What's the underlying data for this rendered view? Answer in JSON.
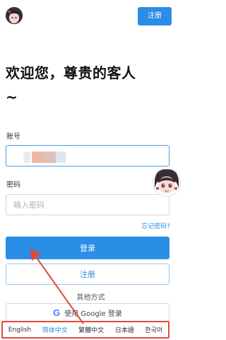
{
  "header": {
    "register_label": "注册"
  },
  "welcome": {
    "line1": "欢迎您，尊贵的客人",
    "line2": "~"
  },
  "form": {
    "account_label": "账号",
    "password_label": "密码",
    "password_placeholder": "输入密码",
    "forgot_label": "忘记密码?",
    "login_label": "登录",
    "register_label": "注册"
  },
  "other": {
    "label": "其他方式",
    "google_label": "使用 Google 登录"
  },
  "languages": [
    {
      "label": "English",
      "active": false
    },
    {
      "label": "简体中文",
      "active": true
    },
    {
      "label": "繁體中文",
      "active": false
    },
    {
      "label": "日本語",
      "active": false
    },
    {
      "label": "한국어",
      "active": false
    }
  ],
  "colors": {
    "accent": "#2a8de6",
    "annotation": "#e04a3b"
  }
}
